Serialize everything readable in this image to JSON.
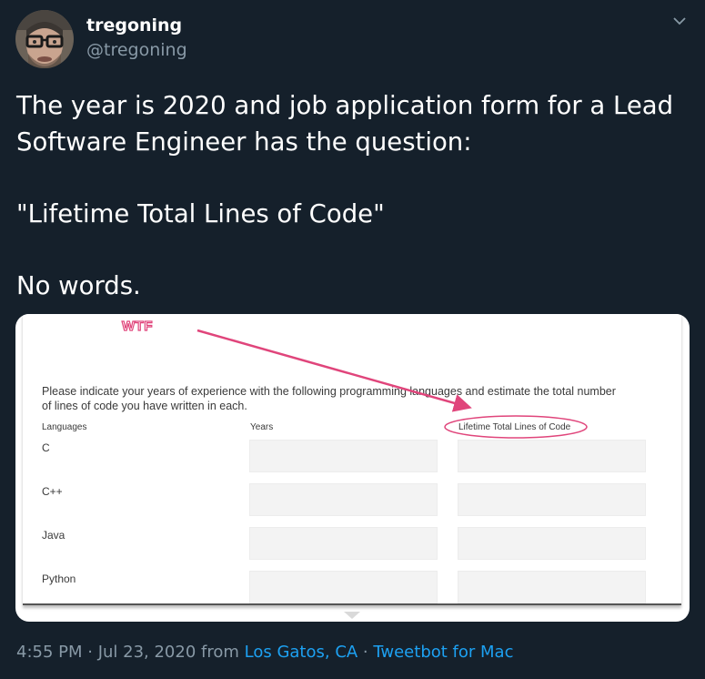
{
  "user": {
    "display_name": "tregoning",
    "handle": "@tregoning",
    "avatar_icon": "user-avatar"
  },
  "tweet": {
    "lines": [
      "The year is 2020 and job application form for a Lead",
      "Software Engineer has the question:",
      "\"Lifetime Total Lines of Code\"",
      "No words."
    ]
  },
  "media": {
    "annotation": "WTF",
    "form": {
      "intro_line1": "Please indicate your years of experience with the following programming languages and estimate the total number",
      "intro_line2": "of lines of code you have written in each.",
      "col_languages": "Languages",
      "col_years": "Years",
      "col_lines": "Lifetime Total Lines of Code",
      "languages": [
        "C",
        "C++",
        "Java",
        "Python"
      ]
    }
  },
  "footer": {
    "time": "4:55 PM · Jul 23, 2020 from ",
    "location": "Los Gatos, CA",
    "separator": " · ",
    "source": "Tweetbot for Mac"
  },
  "colors": {
    "background": "#15202b",
    "link": "#1da1f2",
    "secondary": "#8899a6",
    "annotation": "#e0457b"
  }
}
